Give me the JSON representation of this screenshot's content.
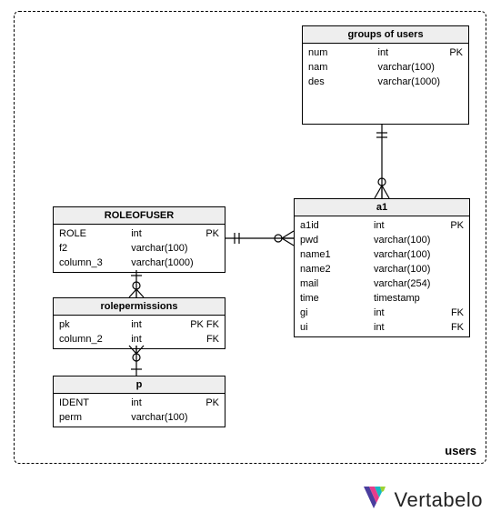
{
  "area_label": "users",
  "brand": "Vertabelo",
  "entities": {
    "groups": {
      "title": "groups of users",
      "rows": [
        {
          "name": "num",
          "type": "int",
          "key": "PK"
        },
        {
          "name": "nam",
          "type": "varchar(100)",
          "key": ""
        },
        {
          "name": "des",
          "type": "varchar(1000)",
          "key": ""
        }
      ]
    },
    "roleofuser": {
      "title": "ROLEOFUSER",
      "rows": [
        {
          "name": "ROLE",
          "type": "int",
          "key": "PK"
        },
        {
          "name": "f2",
          "type": "varchar(100)",
          "key": ""
        },
        {
          "name": "column_3",
          "type": "varchar(1000)",
          "key": ""
        }
      ]
    },
    "a1": {
      "title": "a1",
      "rows": [
        {
          "name": "a1id",
          "type": "int",
          "key": "PK"
        },
        {
          "name": "pwd",
          "type": "varchar(100)",
          "key": ""
        },
        {
          "name": "name1",
          "type": "varchar(100)",
          "key": ""
        },
        {
          "name": "name2",
          "type": "varchar(100)",
          "key": ""
        },
        {
          "name": "mail",
          "type": "varchar(254)",
          "key": ""
        },
        {
          "name": "time",
          "type": "timestamp",
          "key": ""
        },
        {
          "name": "gi",
          "type": "int",
          "key": "FK"
        },
        {
          "name": "ui",
          "type": "int",
          "key": "FK"
        }
      ]
    },
    "rolepermissions": {
      "title": "rolepermissions",
      "rows": [
        {
          "name": "pk",
          "type": "int",
          "key": "PK FK"
        },
        {
          "name": "column_2",
          "type": "int",
          "key": "FK"
        }
      ]
    },
    "p": {
      "title": "p",
      "rows": [
        {
          "name": "IDENT",
          "type": "int",
          "key": "PK"
        },
        {
          "name": "perm",
          "type": "varchar(100)",
          "key": ""
        }
      ]
    }
  },
  "relationships": [
    {
      "from": "groups",
      "to": "a1",
      "type": "one-to-many"
    },
    {
      "from": "roleofuser",
      "to": "a1",
      "type": "one-to-many"
    },
    {
      "from": "roleofuser",
      "to": "rolepermissions",
      "type": "one-to-many"
    },
    {
      "from": "p",
      "to": "rolepermissions",
      "type": "one-to-many"
    }
  ]
}
